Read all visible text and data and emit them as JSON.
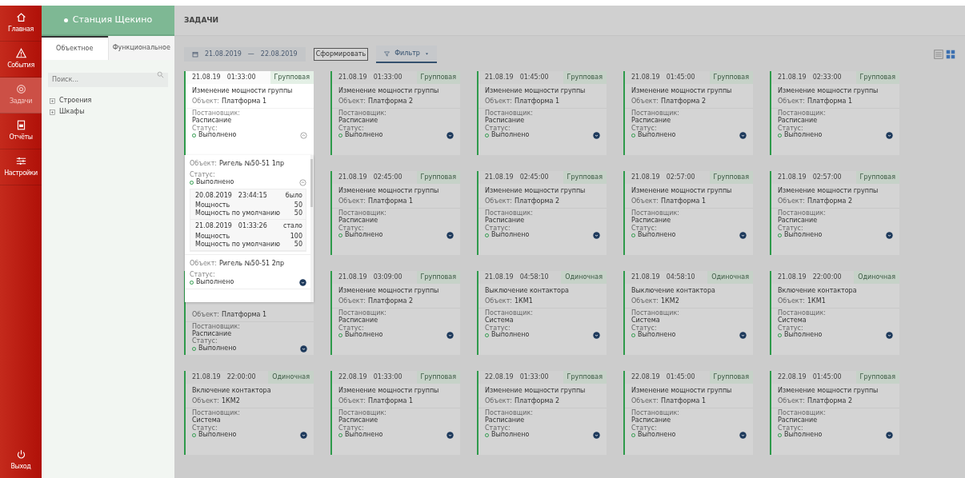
{
  "nav": {
    "items": [
      {
        "label": "Главная",
        "selected": false
      },
      {
        "label": "События",
        "selected": false
      },
      {
        "label": "Задачи",
        "selected": true
      },
      {
        "label": "Отчёты",
        "selected": false
      },
      {
        "label": "Настройки",
        "selected": false
      }
    ],
    "exit": {
      "label": "Выход"
    }
  },
  "panel": {
    "station": "Станция Щекино",
    "tabs": [
      {
        "label": "Объектное",
        "selected": true
      },
      {
        "label": "Функциональное",
        "selected": false
      }
    ],
    "search": {
      "placeholder": "Поиск..."
    },
    "tree": [
      {
        "label": "Строения",
        "expanded": false
      },
      {
        "label": "Шкафы",
        "expanded": false
      }
    ]
  },
  "page": {
    "title": "ЗАДАЧИ"
  },
  "toolbar": {
    "date_from": "21.08.2019",
    "separator": "—",
    "date_to": "22.08.2019",
    "generate_button": "Сформировать",
    "filter_button": "Фильтр"
  },
  "view_toggle": [
    {
      "kind": "list",
      "selected": false
    },
    {
      "kind": "grid",
      "selected": true
    }
  ],
  "cards": [
    {
      "kind": "full",
      "date": "21.08.19",
      "time": "01:33:00",
      "type": "Групповая",
      "title": "Изменение мощности группы",
      "object_label": "Объект:",
      "object": "Платформа 1",
      "author_label": "Постановщик:",
      "author": "Расписание",
      "status_label": "Статус:",
      "status": "Выполнено",
      "expanded": true,
      "details": [
        {
          "object_label": "Объект:",
          "object": "Ригель №50-51 1пр",
          "status_label": "Статус:",
          "status": "Выполнено",
          "expanded": true,
          "history": [
            {
              "date": "20.08.2019",
              "time": "23:44:15",
              "tag": "было",
              "params": [
                {
                  "name": "Мощность",
                  "value": "50"
                },
                {
                  "name": "Мощность по умолчанию",
                  "value": "50"
                }
              ]
            },
            {
              "date": "21.08.2019",
              "time": "01:33:26",
              "tag": "стало",
              "params": [
                {
                  "name": "Мощность",
                  "value": "100"
                },
                {
                  "name": "Мощность по умолчанию",
                  "value": "50"
                }
              ]
            }
          ]
        },
        {
          "object_label": "Объект:",
          "object": "Ригель №50-51 2пр",
          "status_label": "Статус:",
          "status": "Выполнено",
          "expanded": false
        }
      ]
    },
    {
      "kind": "full",
      "date": "21.08.19",
      "time": "01:33:00",
      "type": "Групповая",
      "title": "Изменение мощности группы",
      "object_label": "Объект:",
      "object": "Платформа 2",
      "author_label": "Постановщик:",
      "author": "Расписание",
      "status_label": "Статус:",
      "status": "Выполнено",
      "expanded": false
    },
    {
      "kind": "full",
      "date": "21.08.19",
      "time": "01:45:00",
      "type": "Групповая",
      "title": "Изменение мощности группы",
      "object_label": "Объект:",
      "object": "Платформа 1",
      "author_label": "Постановщик:",
      "author": "Расписание",
      "status_label": "Статус:",
      "status": "Выполнено",
      "expanded": false
    },
    {
      "kind": "full",
      "date": "21.08.19",
      "time": "01:45:00",
      "type": "Групповая",
      "title": "Изменение мощности группы",
      "object_label": "Объект:",
      "object": "Платформа 2",
      "author_label": "Постановщик:",
      "author": "Расписание",
      "status_label": "Статус:",
      "status": "Выполнено",
      "expanded": false
    },
    {
      "kind": "full",
      "date": "21.08.19",
      "time": "02:33:00",
      "type": "Групповая",
      "title": "Изменение мощности группы",
      "object_label": "Объект:",
      "object": "Платформа 1",
      "author_label": "Постановщик:",
      "author": "Расписание",
      "status_label": "Статус:",
      "status": "Выполнено",
      "expanded": false
    },
    {
      "kind": "covered"
    },
    {
      "kind": "full",
      "date": "21.08.19",
      "time": "02:45:00",
      "type": "Групповая",
      "title": "Изменение мощности группы",
      "object_label": "Объект:",
      "object": "Платформа 1",
      "author_label": "Постановщик:",
      "author": "Расписание",
      "status_label": "Статус:",
      "status": "Выполнено",
      "expanded": false
    },
    {
      "kind": "full",
      "date": "21.08.19",
      "time": "02:45:00",
      "type": "Групповая",
      "title": "Изменение мощности группы",
      "object_label": "Объект:",
      "object": "Платформа 2",
      "author_label": "Постановщик:",
      "author": "Расписание",
      "status_label": "Статус:",
      "status": "Выполнено",
      "expanded": false
    },
    {
      "kind": "full",
      "date": "21.08.19",
      "time": "02:57:00",
      "type": "Групповая",
      "title": "Изменение мощности группы",
      "object_label": "Объект:",
      "object": "Платформа 1",
      "author_label": "Постановщик:",
      "author": "Расписание",
      "status_label": "Статус:",
      "status": "Выполнено",
      "expanded": false
    },
    {
      "kind": "full",
      "date": "21.08.19",
      "time": "02:57:00",
      "type": "Групповая",
      "title": "Изменение мощности группы",
      "object_label": "Объект:",
      "object": "Платформа 2",
      "author_label": "Постановщик:",
      "author": "Расписание",
      "status_label": "Статус:",
      "status": "Выполнено",
      "expanded": false
    },
    {
      "kind": "partial",
      "object_label": "Объект:",
      "object": "Платформа 1",
      "author_label": "Постановщик:",
      "author": "Расписание",
      "status_label": "Статус:",
      "status": "Выполнено",
      "expanded": false
    },
    {
      "kind": "full",
      "date": "21.08.19",
      "time": "03:09:00",
      "type": "Групповая",
      "title": "Изменение мощности группы",
      "object_label": "Объект:",
      "object": "Платформа 2",
      "author_label": "Постановщик:",
      "author": "Расписание",
      "status_label": "Статус:",
      "status": "Выполнено",
      "expanded": false
    },
    {
      "kind": "full",
      "date": "21.08.19",
      "time": "04:58:10",
      "type": "Одиночная",
      "title": "Выключение контактора",
      "object_label": "Объект:",
      "object": "1КМ1",
      "author_label": "Постановщик:",
      "author": "Система",
      "status_label": "Статус:",
      "status": "Выполнено",
      "expanded": false
    },
    {
      "kind": "full",
      "date": "21.08.19",
      "time": "04:58:10",
      "type": "Одиночная",
      "title": "Выключение контактора",
      "object_label": "Объект:",
      "object": "1КМ2",
      "author_label": "Постановщик:",
      "author": "Система",
      "status_label": "Статус:",
      "status": "Выполнено",
      "expanded": false
    },
    {
      "kind": "full",
      "date": "21.08.19",
      "time": "22:00:00",
      "type": "Одиночная",
      "title": "Включение контактора",
      "object_label": "Объект:",
      "object": "1КМ1",
      "author_label": "Постановщик:",
      "author": "Система",
      "status_label": "Статус:",
      "status": "Выполнено",
      "expanded": false
    },
    {
      "kind": "full",
      "date": "21.08.19",
      "time": "22:00:00",
      "type": "Одиночная",
      "title": "Включение контактора",
      "object_label": "Объект:",
      "object": "1КМ2",
      "author_label": "Постановщик:",
      "author": "Система",
      "status_label": "Статус:",
      "status": "Выполнено",
      "expanded": false
    },
    {
      "kind": "full",
      "date": "22.08.19",
      "time": "01:33:00",
      "type": "Групповая",
      "title": "Изменение мощности группы",
      "object_label": "Объект:",
      "object": "Платформа 1",
      "author_label": "Постановщик:",
      "author": "Расписание",
      "status_label": "Статус:",
      "status": "Выполнено",
      "expanded": false
    },
    {
      "kind": "full",
      "date": "22.08.19",
      "time": "01:33:00",
      "type": "Групповая",
      "title": "Изменение мощности группы",
      "object_label": "Объект:",
      "object": "Платформа 2",
      "author_label": "Постановщик:",
      "author": "Расписание",
      "status_label": "Статус:",
      "status": "Выполнено",
      "expanded": false
    },
    {
      "kind": "full",
      "date": "22.08.19",
      "time": "01:45:00",
      "type": "Групповая",
      "title": "Изменение мощности группы",
      "object_label": "Объект:",
      "object": "Платформа 1",
      "author_label": "Постановщик:",
      "author": "Расписание",
      "status_label": "Статус:",
      "status": "Выполнено",
      "expanded": false
    },
    {
      "kind": "full",
      "date": "22.08.19",
      "time": "01:45:00",
      "type": "Групповая",
      "title": "Изменение мощности группы",
      "object_label": "Объект:",
      "object": "Платформа 2",
      "author_label": "Постановщик:",
      "author": "Расписание",
      "status_label": "Статус:",
      "status": "Выполнено",
      "expanded": false
    }
  ]
}
